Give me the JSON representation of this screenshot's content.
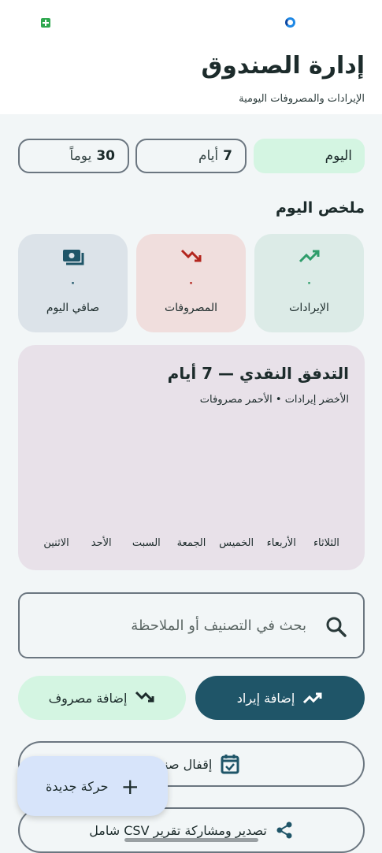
{
  "header": {
    "title": "إدارة الصندوق",
    "subtitle": "الإيرادات والمصروفات اليومية"
  },
  "period": {
    "today": "اليوم",
    "days7_num": "7",
    "days7_unit": "أيام",
    "days30_num": "30",
    "days30_unit": "يوماً",
    "selected": "today"
  },
  "summary": {
    "title": "ملخص اليوم",
    "cards": [
      {
        "label": "الإيرادات",
        "value": "٠",
        "icon": "trending-up-icon",
        "color": "#2f9d6b"
      },
      {
        "label": "المصروفات",
        "value": "٠",
        "icon": "trending-down-icon",
        "color": "#b3261e"
      },
      {
        "label": "صافي اليوم",
        "value": "٠",
        "icon": "cash-icon",
        "color": "#1f5568"
      }
    ]
  },
  "chart": {
    "title": "التدفق النقدي — 7 أيام",
    "subtitle": "الأخضر إيرادات • الأحمر مصروفات"
  },
  "chart_data": {
    "type": "bar",
    "categories": [
      "الاثنين",
      "الأحد",
      "السبت",
      "الجمعة",
      "الخميس",
      "الأربعاء",
      "الثلاثاء"
    ],
    "series": [
      {
        "name": "إيرادات",
        "values": [
          0,
          0,
          0,
          0,
          0,
          0,
          0
        ]
      },
      {
        "name": "مصروفات",
        "values": [
          0,
          0,
          0,
          0,
          0,
          0,
          0
        ]
      }
    ],
    "title": "التدفق النقدي — 7 أيام",
    "xlabel": "",
    "ylabel": "",
    "legend": "الأخضر إيرادات • الأحمر مصروفات"
  },
  "search": {
    "placeholder": "بحث في التصنيف أو الملاحظة"
  },
  "actions": {
    "add_income": "إضافة إيراد",
    "add_expense": "إضافة مصروف",
    "close_fund": "إقفال صندوق",
    "export_csv": "تصدير ومشاركة تقرير CSV شامل"
  },
  "fab": {
    "label": "حركة جديدة"
  },
  "colors": {
    "primary": "#1f5568",
    "income": "#2f9d6b",
    "expense": "#b3261e",
    "chip_selected": "#d4f5e2"
  }
}
